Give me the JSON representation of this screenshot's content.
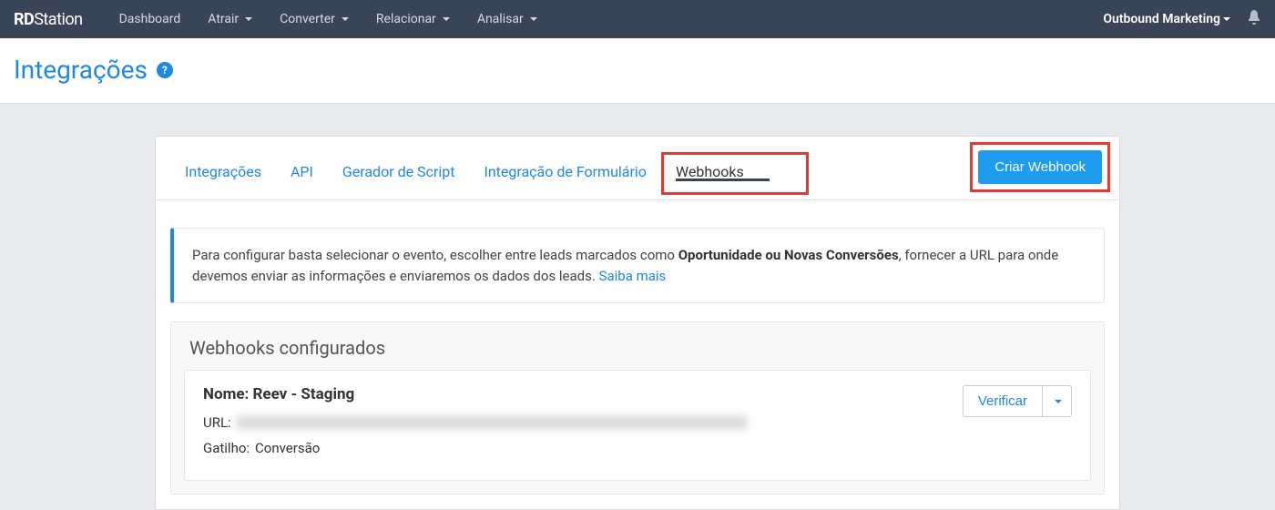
{
  "brand": {
    "bold": "RD",
    "light": "Station"
  },
  "nav": {
    "items": [
      "Dashboard",
      "Atrair",
      "Converter",
      "Relacionar",
      "Analisar"
    ],
    "user": "Outbound Marketing"
  },
  "page": {
    "title": "Integrações"
  },
  "tabs": {
    "items": [
      "Integrações",
      "API",
      "Gerador de Script",
      "Integração de Formulário",
      "Webhooks"
    ],
    "active": "Webhooks",
    "create_button": "Criar Webhook"
  },
  "info": {
    "text_before": "Para configurar basta selecionar o evento, escolher entre leads marcados como ",
    "bold": "Oportunidade ou Novas Conversões",
    "text_after": ", fornecer a URL para onde devemos enviar as informações e enviaremos os dados dos leads. ",
    "link": "Saiba mais"
  },
  "section": {
    "title": "Webhooks configurados",
    "webhooks": [
      {
        "name_label": "Nome: ",
        "name_value": "Reev - Staging",
        "url_label": "URL:",
        "trigger_label": "Gatilho: ",
        "trigger_value": "Conversão",
        "verify_button": "Verificar"
      }
    ]
  }
}
